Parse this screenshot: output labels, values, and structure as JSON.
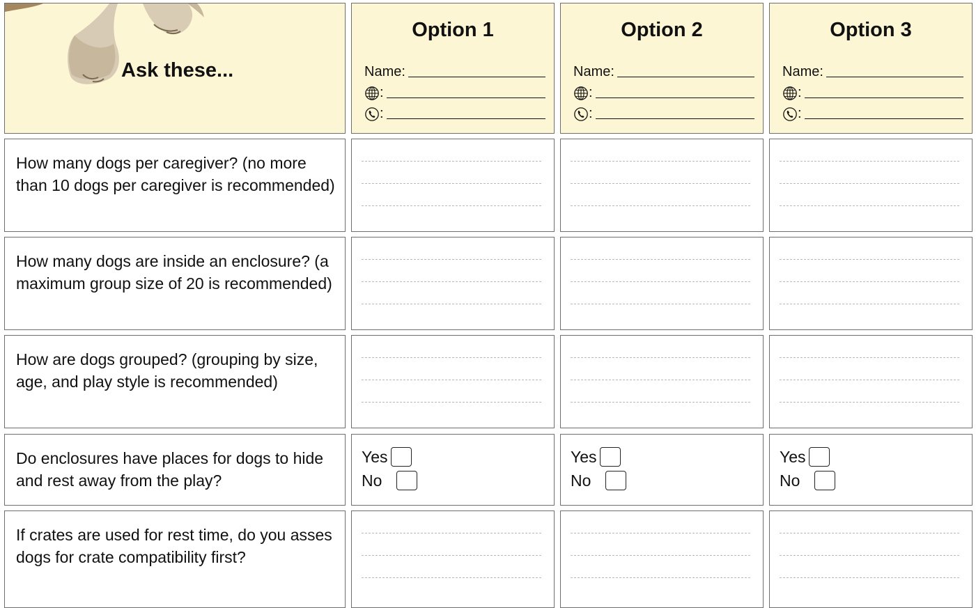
{
  "header": {
    "ask_label": "Ask these...",
    "options": [
      {
        "title": "Option 1",
        "name_label": "Name:",
        "web_sep": ":",
        "phone_sep": ":"
      },
      {
        "title": "Option 2",
        "name_label": "Name:",
        "web_sep": ":",
        "phone_sep": ":"
      },
      {
        "title": "Option 3",
        "name_label": "Name:",
        "web_sep": ":",
        "phone_sep": ":"
      }
    ],
    "icons": {
      "web": "globe-icon",
      "phone": "phone-icon",
      "mascot": "dog-paws-image"
    }
  },
  "questions": [
    {
      "text": "How many dogs per caregiver? (no more than 10 dogs per caregiver is recommended)",
      "type": "lines"
    },
    {
      "text": "How many dogs are inside an enclosure? (a maximum group size of 20 is recommended)",
      "type": "lines"
    },
    {
      "text": "How are dogs grouped? (grouping by size, age, and play style is recommended)",
      "type": "lines"
    },
    {
      "text": "Do enclosures have places for dogs to hide and rest away from the play?",
      "type": "yesno"
    },
    {
      "text": "If crates are used for rest time, do you asses dogs for crate compatibility first?",
      "type": "lines"
    }
  ],
  "answer": {
    "yes_label": "Yes",
    "no_label": "No"
  },
  "colors": {
    "header_bg": "#fdf6d4",
    "border": "#6e6e6e",
    "write_line": "#b9b9b9"
  }
}
